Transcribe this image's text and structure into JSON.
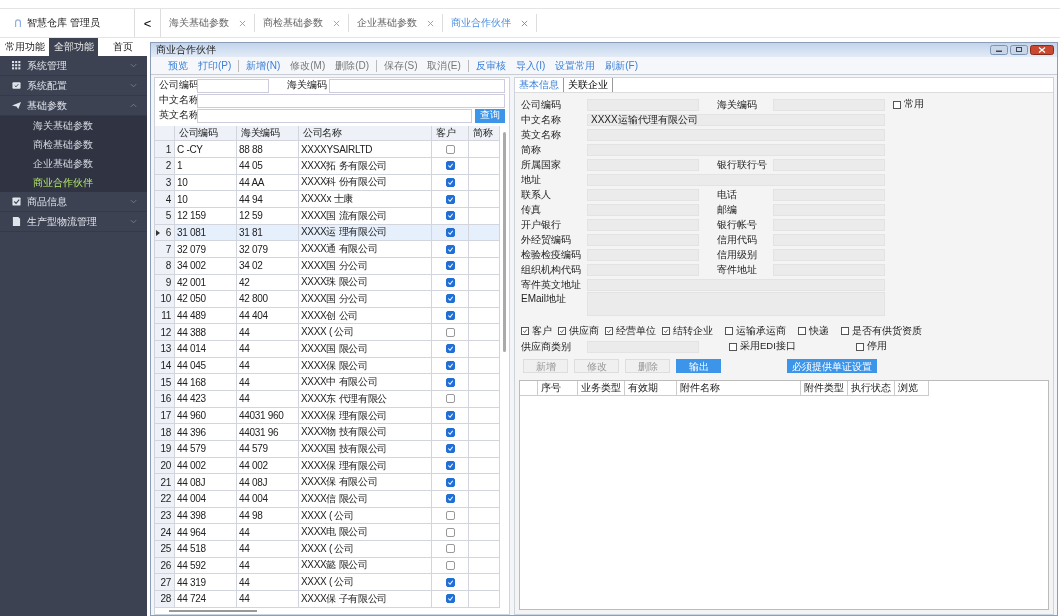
{
  "app": {
    "title": "智慧仓库 管理员",
    "collapse": "<"
  },
  "top_tabs": [
    {
      "label": "海关基础参数",
      "selected": false
    },
    {
      "label": "商检基础参数",
      "selected": false
    },
    {
      "label": "企业基础参数",
      "selected": false
    },
    {
      "label": "商业合作伙伴",
      "selected": true
    }
  ],
  "sidebar": {
    "tabs": [
      {
        "label": "常用功能",
        "selected": false
      },
      {
        "label": "全部功能",
        "selected": true
      },
      {
        "label": "首页",
        "selected": false
      }
    ],
    "items": [
      {
        "label": "系统管理",
        "expanded": false
      },
      {
        "label": "系统配置",
        "expanded": false
      },
      {
        "label": "基础参数",
        "expanded": true,
        "children": [
          {
            "label": "海关基础参数",
            "selected": false
          },
          {
            "label": "商检基础参数",
            "selected": false
          },
          {
            "label": "企业基础参数",
            "selected": false
          },
          {
            "label": "商业合作伙伴",
            "selected": true
          }
        ]
      },
      {
        "label": "商品信息",
        "expanded": false
      },
      {
        "label": "生产型物流管理",
        "expanded": false
      }
    ]
  },
  "window": {
    "title": "商业合作伙伴"
  },
  "toolbar": [
    {
      "label": "预览",
      "disabled": false,
      "sep": false
    },
    {
      "label": "打印(P)",
      "disabled": false,
      "sep": true
    },
    {
      "label": "新增(N)",
      "disabled": false,
      "sep": false
    },
    {
      "label": "修改(M)",
      "disabled": true,
      "sep": false
    },
    {
      "label": "删除(D)",
      "disabled": true,
      "sep": true
    },
    {
      "label": "保存(S)",
      "disabled": true,
      "sep": false
    },
    {
      "label": "取消(E)",
      "disabled": true,
      "sep": true
    },
    {
      "label": "反审核",
      "disabled": false,
      "sep": false
    },
    {
      "label": "导入(I)",
      "disabled": false,
      "sep": false
    },
    {
      "label": "设置常用",
      "disabled": false,
      "sep": false
    },
    {
      "label": "刷新(F)",
      "disabled": false,
      "sep": false
    }
  ],
  "search": {
    "company_code": "公司编码",
    "customs_code": "海关编码",
    "cn_name": "中文名称",
    "en_name": "英文名称",
    "button": "查询"
  },
  "table": {
    "columns": [
      "公司编码",
      "海关编码",
      "公司名称",
      "客户",
      "简称"
    ],
    "rows": [
      {
        "no": "1",
        "code": "C      -CY",
        "customs": "88        88",
        "name": "XXXXYSAIRLTD",
        "customer": false,
        "selected": false
      },
      {
        "no": "2",
        "code": "1",
        "customs": "44        05",
        "name": "XXXX拓       务有限公司",
        "customer": true,
        "selected": false
      },
      {
        "no": "3",
        "code": "10",
        "customs": "44        AA",
        "name": "XXXX科       份有限公司",
        "customer": true,
        "selected": false
      },
      {
        "no": "4",
        "code": "10",
        "customs": "44        94",
        "name": "XXXXx        士康",
        "customer": true,
        "selected": false
      },
      {
        "no": "5",
        "code": "12       159",
        "customs": "12        59",
        "name": "XXXX国       流有限公司",
        "customer": true,
        "selected": false
      },
      {
        "no": "6",
        "code": "31       081",
        "customs": "31        81",
        "name": "XXXX运       理有限公司",
        "customer": true,
        "selected": true
      },
      {
        "no": "7",
        "code": "32       079",
        "customs": "32       079",
        "name": "XXXX通       有限公司",
        "customer": true,
        "selected": false
      },
      {
        "no": "8",
        "code": "34       002",
        "customs": "34        02",
        "name": "XXXX国       分公司",
        "customer": true,
        "selected": false
      },
      {
        "no": "9",
        "code": "42       001",
        "customs": "42",
        "name": "XXXX珠       限公司",
        "customer": true,
        "selected": false
      },
      {
        "no": "10",
        "code": "42       050",
        "customs": "42       800",
        "name": "XXXX国       分公司",
        "customer": true,
        "selected": false
      },
      {
        "no": "11",
        "code": "44       489",
        "customs": "44       404",
        "name": "XXXX创       公司",
        "customer": true,
        "selected": false
      },
      {
        "no": "12",
        "code": "44       388",
        "customs": "44",
        "name": "XXXX (       公司",
        "customer": false,
        "selected": false
      },
      {
        "no": "13",
        "code": "44       014",
        "customs": "44",
        "name": "XXXX国       限公司",
        "customer": true,
        "selected": false
      },
      {
        "no": "14",
        "code": "44       045",
        "customs": "44",
        "name": "XXXX保       限公司",
        "customer": true,
        "selected": false
      },
      {
        "no": "15",
        "code": "44       168",
        "customs": "44",
        "name": "XXXX中       有限公司",
        "customer": true,
        "selected": false
      },
      {
        "no": "16",
        "code": "44       423",
        "customs": "44",
        "name": "XXXX东       代理有限公",
        "customer": false,
        "selected": false
      },
      {
        "no": "17",
        "code": "44       960",
        "customs": "44031     960",
        "name": "XXXX保       理有限公司",
        "customer": true,
        "selected": false
      },
      {
        "no": "18",
        "code": "44       396",
        "customs": "44031      96",
        "name": "XXXX物       技有限公司",
        "customer": true,
        "selected": false
      },
      {
        "no": "19",
        "code": "44       579",
        "customs": "44        579",
        "name": "XXXX国       技有限公司",
        "customer": true,
        "selected": false
      },
      {
        "no": "20",
        "code": "44       002",
        "customs": "44        002",
        "name": "XXXX保       理有限公司",
        "customer": true,
        "selected": false
      },
      {
        "no": "21",
        "code": "44       08J",
        "customs": "44        08J",
        "name": "XXXX保       有限公司",
        "customer": true,
        "selected": false
      },
      {
        "no": "22",
        "code": "44       004",
        "customs": "44        004",
        "name": "XXXX信       限公司",
        "customer": true,
        "selected": false
      },
      {
        "no": "23",
        "code": "44       398",
        "customs": "44         98",
        "name": "XXXX (       公司",
        "customer": false,
        "selected": false
      },
      {
        "no": "24",
        "code": "44       964",
        "customs": "44",
        "name": "XXXX电       限公司",
        "customer": false,
        "selected": false
      },
      {
        "no": "25",
        "code": "44       518",
        "customs": "44",
        "name": "XXXX (       公司",
        "customer": false,
        "selected": false
      },
      {
        "no": "26",
        "code": "44       592",
        "customs": "44",
        "name": "XXXX懿       限公司",
        "customer": false,
        "selected": false
      },
      {
        "no": "27",
        "code": "44       319",
        "customs": "44",
        "name": "XXXX (       公司",
        "customer": true,
        "selected": false
      },
      {
        "no": "28",
        "code": "44       724",
        "customs": "44",
        "name": "XXXX保       子有限公司",
        "customer": true,
        "selected": false
      }
    ]
  },
  "detail_tabs": [
    {
      "label": "基本信息",
      "selected": true
    },
    {
      "label": "关联企业",
      "selected": false
    }
  ],
  "form": {
    "common": {
      "label": "常用",
      "checked": false
    },
    "rows": [
      {
        "kind": "half",
        "fields": [
          {
            "label": "公司编码"
          },
          {
            "label": "海关编码"
          }
        ]
      },
      {
        "kind": "full",
        "fields": [
          {
            "label": "中文名称",
            "value": "XXXX运输代理有限公司"
          }
        ]
      },
      {
        "kind": "full",
        "fields": [
          {
            "label": "英文名称"
          }
        ]
      },
      {
        "kind": "full",
        "fields": [
          {
            "label": "简称"
          }
        ]
      },
      {
        "kind": "half",
        "fields": [
          {
            "label": "所属国家"
          },
          {
            "label": "银行联行号"
          }
        ]
      },
      {
        "kind": "full",
        "fields": [
          {
            "label": "地址"
          }
        ]
      },
      {
        "kind": "half",
        "fields": [
          {
            "label": "联系人"
          },
          {
            "label": "电话"
          }
        ]
      },
      {
        "kind": "half",
        "fields": [
          {
            "label": "传真"
          },
          {
            "label": "邮编"
          }
        ]
      },
      {
        "kind": "half",
        "fields": [
          {
            "label": "开户银行"
          },
          {
            "label": "银行帐号"
          }
        ]
      },
      {
        "kind": "half",
        "fields": [
          {
            "label": "外经贸编码"
          },
          {
            "label": "信用代码"
          }
        ]
      },
      {
        "kind": "half",
        "fields": [
          {
            "label": "检验检疫编码"
          },
          {
            "label": "信用级别"
          }
        ]
      },
      {
        "kind": "half",
        "fields": [
          {
            "label": "组织机构代码"
          },
          {
            "label": "寄件地址"
          }
        ]
      },
      {
        "kind": "full",
        "fields": [
          {
            "label": "寄件英文地址"
          }
        ]
      },
      {
        "kind": "tall",
        "fields": [
          {
            "label": "EMail地址"
          }
        ]
      }
    ],
    "flags": [
      {
        "label": "客户",
        "checked": true
      },
      {
        "label": "供应商",
        "checked": true
      },
      {
        "label": "经营单位",
        "checked": true
      },
      {
        "label": "结转企业",
        "checked": true
      },
      {
        "label": "运输承运商",
        "checked": false
      },
      {
        "label": "快递",
        "checked": false
      },
      {
        "label": "是否有供货资质",
        "checked": false
      }
    ],
    "supplier_type": "供应商类别",
    "edi": {
      "label": "采用EDI接口",
      "checked": false
    },
    "disabled_flag": {
      "label": "停用",
      "checked": false
    }
  },
  "actions": [
    {
      "label": "新增",
      "kind": "disabled"
    },
    {
      "label": "修改",
      "kind": "disabled"
    },
    {
      "label": "删除",
      "kind": "disabled"
    },
    {
      "label": "输出",
      "kind": "primary"
    },
    {
      "label": "必须提供单证设置",
      "kind": "wide"
    }
  ],
  "attachments": {
    "columns": [
      "序号",
      "业务类型",
      "有效期",
      "附件名称",
      "附件类型",
      "执行状态",
      "浏览"
    ]
  }
}
